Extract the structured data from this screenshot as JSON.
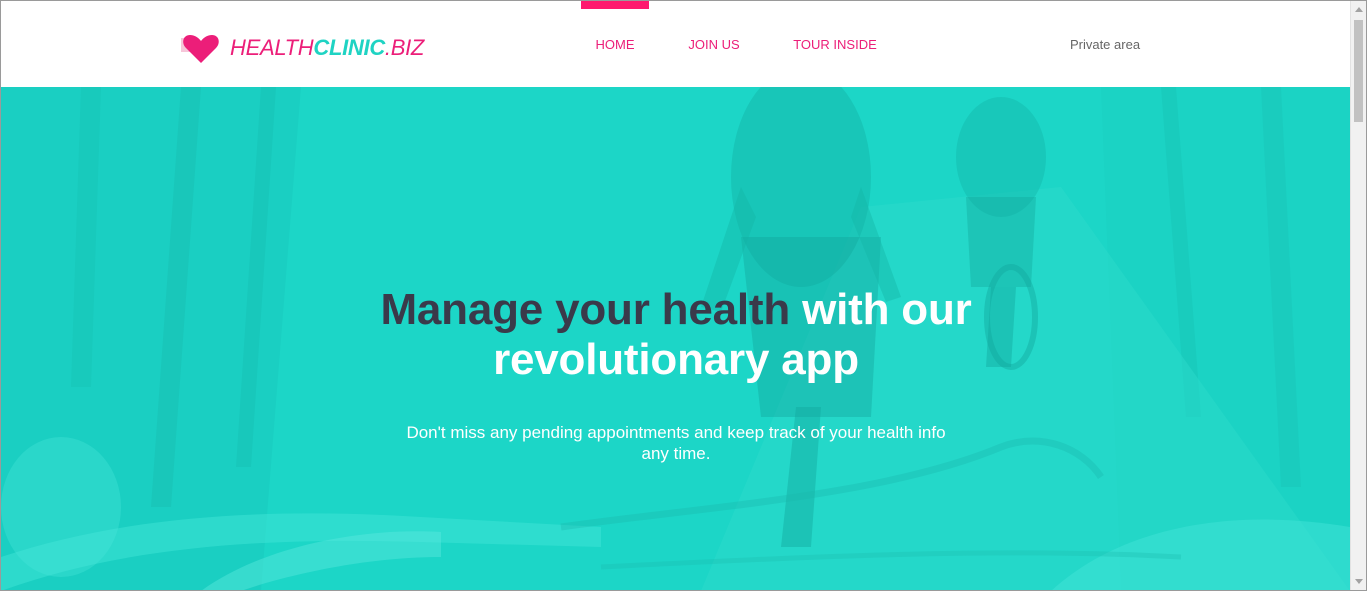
{
  "brand": {
    "part1": "HEALTH",
    "part2": "CLINIC",
    "part3": ".BIZ",
    "logo_icon": "heart-icon",
    "pink": "#ec1e79",
    "teal": "#1fd3c3"
  },
  "nav": {
    "items": [
      {
        "label": "HOME",
        "active": true
      },
      {
        "label": "JOIN US",
        "active": false
      },
      {
        "label": "TOUR INSIDE",
        "active": false
      }
    ],
    "private_label": "Private area"
  },
  "hero": {
    "title_dark": "Manage your health",
    "title_light": "with our revolutionary app",
    "subtitle": "Don't miss any pending appointments and keep track of your health info any time.",
    "overlay_color": "#1cd6c7",
    "dark_text_color": "#3a3a4a"
  }
}
